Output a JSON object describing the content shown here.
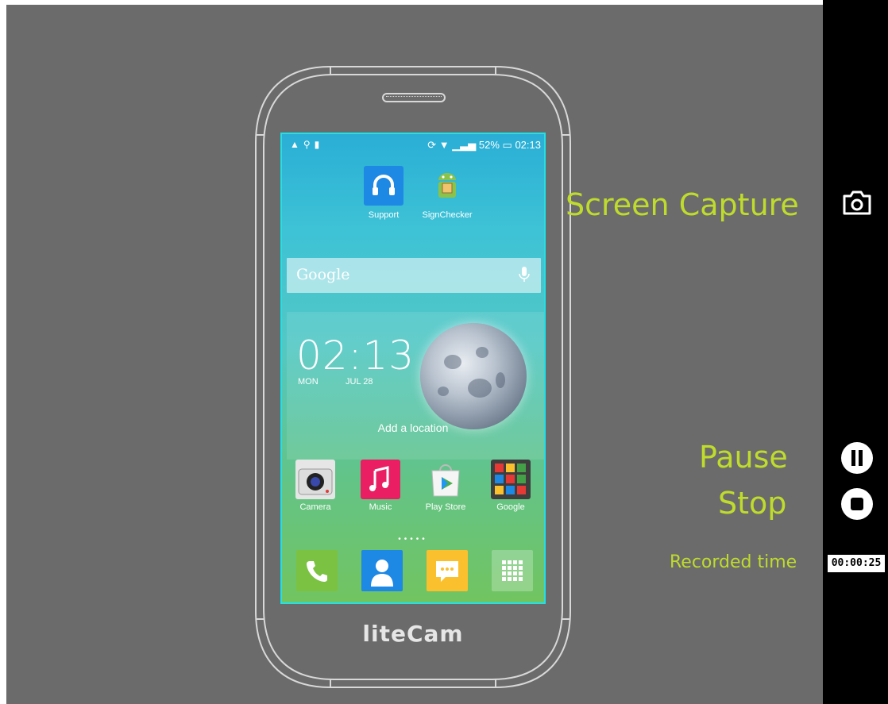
{
  "window": {
    "brand": "liteCam"
  },
  "controls": {
    "screen_capture_label": "Screen Capture",
    "pause_label": "Pause",
    "stop_label": "Stop",
    "recorded_time_label": "Recorded time",
    "recorded_time_value": "00:00:25",
    "camera_icon": "camera-icon",
    "pause_icon": "pause-icon",
    "stop_icon": "stop-icon",
    "accent_color": "#bfdc2c"
  },
  "phone": {
    "status_bar": {
      "battery": "52%",
      "time": "02:13"
    },
    "top_apps": [
      {
        "label": "Support",
        "icon": "headset-icon"
      },
      {
        "label": "SignChecker",
        "icon": "android-icon"
      }
    ],
    "search": {
      "placeholder": "Google",
      "icon": "microphone-icon"
    },
    "clock_widget": {
      "time": "02:13",
      "day": "MON",
      "date": "JUL 28",
      "location_prompt": "Add a location"
    },
    "dock_apps": [
      {
        "label": "Camera",
        "icon": "camera-app-icon"
      },
      {
        "label": "Music",
        "icon": "music-icon"
      },
      {
        "label": "Play Store",
        "icon": "play-store-icon"
      },
      {
        "label": "Google",
        "icon": "google-folder-icon"
      }
    ],
    "bottom_apps": [
      {
        "icon": "phone-icon"
      },
      {
        "icon": "contacts-icon"
      },
      {
        "icon": "messages-icon"
      },
      {
        "icon": "apps-grid-icon"
      }
    ],
    "screen_border_color": "#22e0e6"
  }
}
